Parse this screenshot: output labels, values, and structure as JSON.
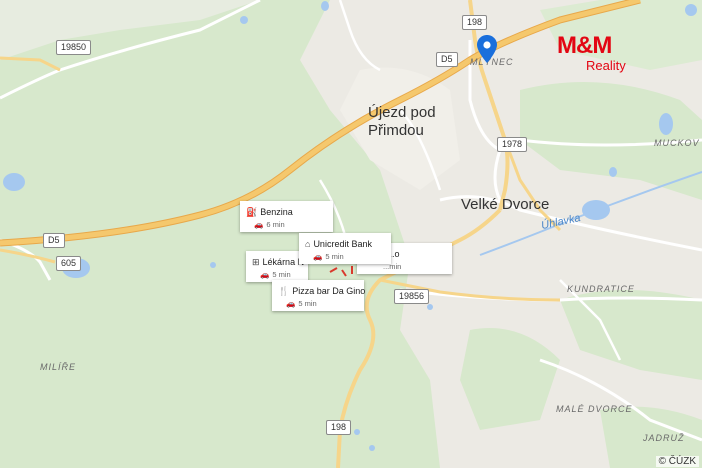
{
  "places": {
    "ujezd_line1": "Újezd pod",
    "ujezd_line2": "Přimdou",
    "velke_dvorce": "Velké Dvorce",
    "milinec": "MLÝNEC",
    "mileire": "MILÍŘE",
    "kundratice": "KUNDRATICE",
    "male_dvorce": "MALÉ DVORCE",
    "muckov": "MUCKOV",
    "jadruz": "JADRUŽ"
  },
  "water": {
    "uhlavka": "Úhlavka"
  },
  "roads": {
    "r198_top": "198",
    "r19850": "19850",
    "d5_top": "D5",
    "r1978": "1978",
    "d5_left": "D5",
    "r605": "605",
    "r19856": "19856",
    "r198_bottom": "198"
  },
  "poi_cards": [
    {
      "name": "Benzina",
      "icon": "fuel-station-icon",
      "time": "6 min"
    },
    {
      "name": "Unicredit Bank",
      "icon": "bank-icon",
      "time": "5 min"
    },
    {
      "name": "Lékárna N",
      "icon": "pharmacy-icon",
      "time": "5 min"
    },
    {
      "name": "Pizza bar Da Gino",
      "icon": "restaurant-icon",
      "time": "5 min"
    },
    {
      "name": "...o",
      "icon": "unknown",
      "time": "...min"
    }
  ],
  "logo": {
    "brand": "M&M",
    "sub": "Reality"
  },
  "attribution": "© ČÚZK",
  "colors": {
    "forest": "#d7e8cc",
    "urban": "#eceae4",
    "water": "#a5c8ef",
    "road_major": "#f5c86d",
    "road_minor": "#ffffff",
    "pin": "#1a6fdc",
    "brand": "#e30613"
  }
}
